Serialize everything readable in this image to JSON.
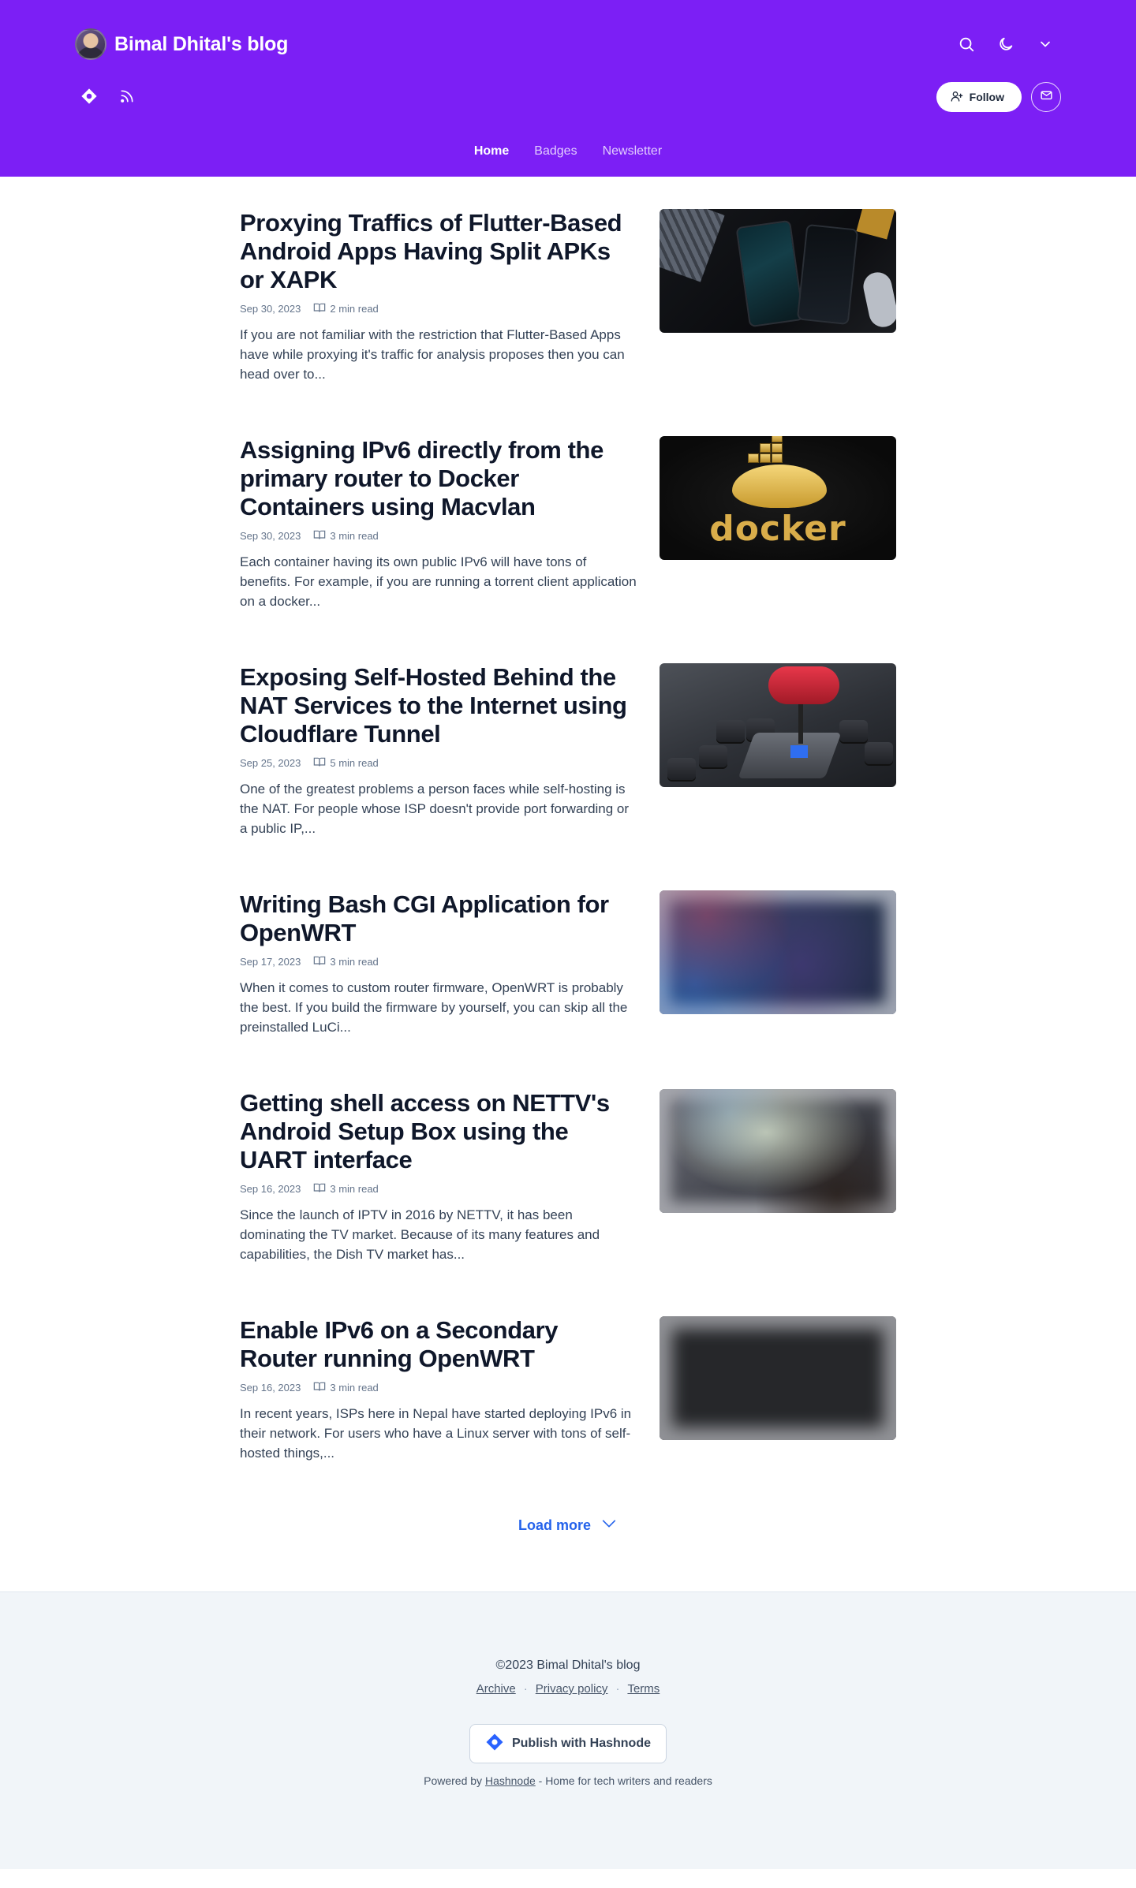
{
  "header": {
    "blog_title": "Bimal Dhital's blog",
    "follow_label": "Follow",
    "nav": [
      {
        "label": "Home"
      },
      {
        "label": "Badges"
      },
      {
        "label": "Newsletter"
      }
    ]
  },
  "icons": {
    "search": "search-icon",
    "theme": "moon-icon",
    "menu": "chevron-down-icon",
    "hashnode": "hashnode-icon",
    "rss": "rss-icon",
    "follow": "user-plus-icon",
    "newsletter": "mail-icon",
    "read_time": "book-icon"
  },
  "colors": {
    "header_bg": "#7c1ff5",
    "accent_link": "#2563eb",
    "footer_bg": "#f1f5f9"
  },
  "posts": [
    {
      "title": "Proxying Traffics of Flutter-Based Android Apps Having Split APKs or XAPK",
      "date": "Sep 30, 2023",
      "read_time": "2 min read",
      "excerpt": "If you are not familiar with the restriction that Flutter-Based Apps have while proxying it's traffic for analysis proposes then you can head over to..."
    },
    {
      "title": "Assigning IPv6 directly from the primary router to Docker Containers using Macvlan",
      "date": "Sep 30, 2023",
      "read_time": "3 min read",
      "excerpt": "Each container having its own public IPv6 will have tons of benefits. For example, if you are running a torrent client application on a docker...",
      "image_text": "docker"
    },
    {
      "title": "Exposing Self-Hosted Behind the NAT Services to the Internet using Cloudflare Tunnel",
      "date": "Sep 25, 2023",
      "read_time": "5 min read",
      "excerpt": "One of the greatest problems a person faces while self-hosting is the NAT. For people whose ISP doesn't provide port forwarding or a public IP,..."
    },
    {
      "title": "Writing Bash CGI Application for OpenWRT",
      "date": "Sep 17, 2023",
      "read_time": "3 min read",
      "excerpt": "When it comes to custom router firmware, OpenWRT is probably the best. If you build the firmware by yourself, you can skip all the preinstalled LuCi..."
    },
    {
      "title": "Getting shell access on NETTV's Android Setup Box using the UART interface",
      "date": "Sep 16, 2023",
      "read_time": "3 min read",
      "excerpt": "Since the launch of IPTV in 2016 by NETTV, it has been dominating the TV market. Because of its many features and capabilities, the Dish TV market has..."
    },
    {
      "title": "Enable IPv6 on a Secondary Router running OpenWRT",
      "date": "Sep 16, 2023",
      "read_time": "3 min read",
      "excerpt": "In recent years, ISPs here in Nepal have started deploying IPv6 in their network. For users who have a Linux server with tons of self-hosted things,..."
    }
  ],
  "load_more_label": "Load more",
  "footer": {
    "copyright": "©2023 Bimal Dhital's blog",
    "links": [
      {
        "label": "Archive"
      },
      {
        "label": "Privacy policy"
      },
      {
        "label": "Terms"
      }
    ],
    "separator": "·",
    "publish_label": "Publish with Hashnode",
    "powered_prefix": "Powered by",
    "powered_link": "Hashnode",
    "powered_suffix": "- Home for tech writers and readers"
  }
}
